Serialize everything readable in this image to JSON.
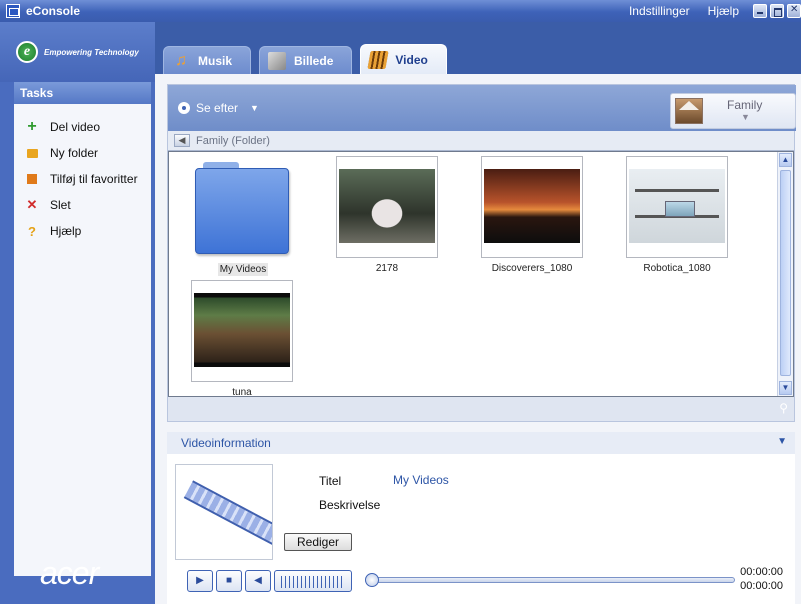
{
  "window": {
    "title": "eConsole",
    "menu": [
      "Indstillinger",
      "Hjælp"
    ]
  },
  "brand": {
    "tagline": "Empowering Technology",
    "logo_text": "acer"
  },
  "tasks": {
    "header": "Tasks",
    "items": [
      {
        "label": "Del video",
        "icon": "plus-icon"
      },
      {
        "label": "Ny folder",
        "icon": "new-folder-icon"
      },
      {
        "label": "Tilføj til favoritter",
        "icon": "add-favorite-icon"
      },
      {
        "label": "Slet",
        "icon": "delete-icon"
      },
      {
        "label": "Hjælp",
        "icon": "help-icon"
      }
    ]
  },
  "tabs": [
    {
      "label": "Musik",
      "icon": "music-icon",
      "active": false
    },
    {
      "label": "Billede",
      "icon": "photo-icon",
      "active": false
    },
    {
      "label": "Video",
      "icon": "video-icon",
      "active": true
    }
  ],
  "toolbar": {
    "view_label": "Se efter",
    "album_label": "Family"
  },
  "path": {
    "current": "Family (Folder)"
  },
  "files": [
    {
      "name": "My Videos",
      "kind": "folder",
      "selected": true
    },
    {
      "name": "2178",
      "kind": "video"
    },
    {
      "name": "Discoverers_1080",
      "kind": "video"
    },
    {
      "name": "Robotica_1080",
      "kind": "video"
    },
    {
      "name": "tuna",
      "kind": "video"
    }
  ],
  "video_info": {
    "header": "Videoinformation",
    "title_label": "Titel",
    "title_value": "My Videos",
    "description_label": "Beskrivelse",
    "edit_button": "Rediger",
    "time_position": "00:00:00",
    "time_duration": "00:00:00"
  },
  "colors": {
    "accent": "#3b5da8",
    "link": "#2d55a6"
  }
}
